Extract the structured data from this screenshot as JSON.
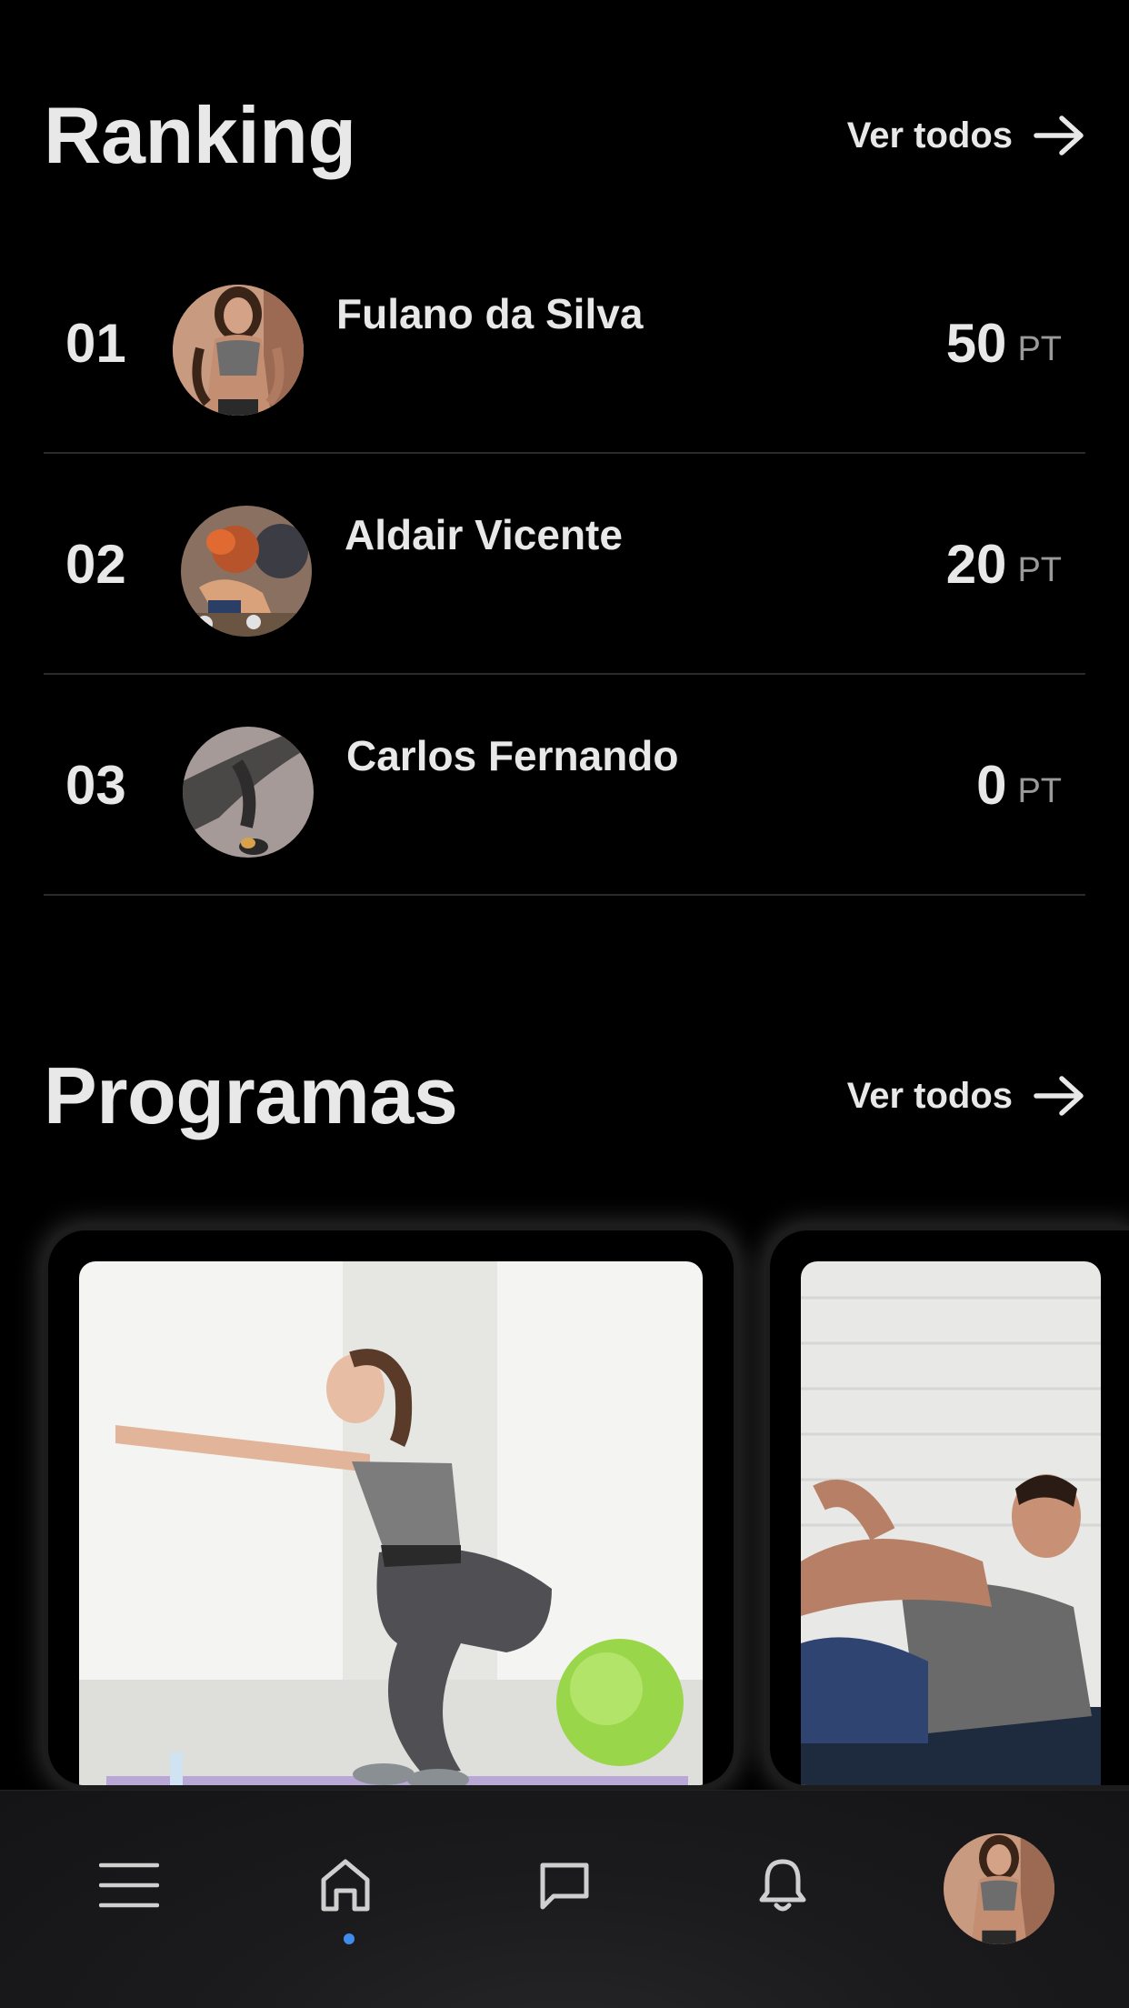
{
  "ranking": {
    "title": "Ranking",
    "see_all_label": "Ver todos",
    "entries": [
      {
        "position": "01",
        "name": "Fulano da Silva",
        "points": "50",
        "unit": "PT"
      },
      {
        "position": "02",
        "name": "Aldair Vicente",
        "points": "20",
        "unit": "PT"
      },
      {
        "position": "03",
        "name": "Carlos Fernando",
        "points": "0",
        "unit": "PT"
      }
    ]
  },
  "programs": {
    "title": "Programas",
    "see_all_label": "Ver todos",
    "cards": [
      {
        "image": "woman-squat-photo"
      },
      {
        "image": "man-crunch-photo"
      }
    ]
  },
  "bottom_nav": {
    "items": [
      {
        "icon": "menu-icon"
      },
      {
        "icon": "home-icon",
        "active": true
      },
      {
        "icon": "chat-icon"
      },
      {
        "icon": "bell-icon"
      },
      {
        "icon": "profile-avatar"
      }
    ],
    "active_color": "#3f8dea"
  }
}
